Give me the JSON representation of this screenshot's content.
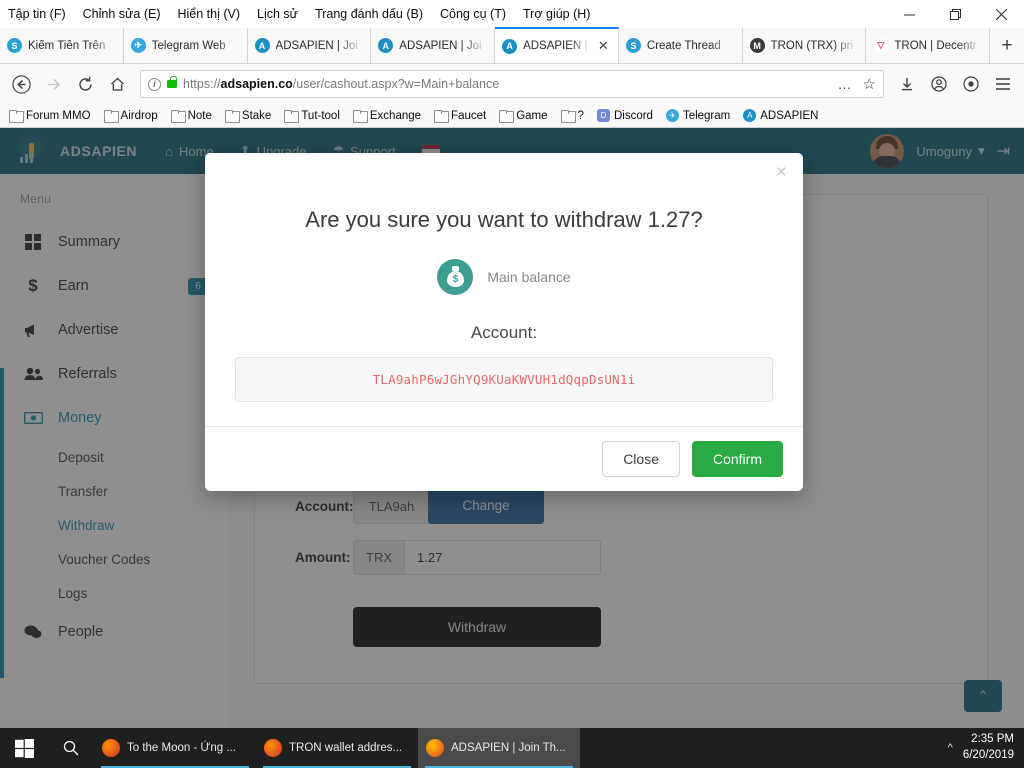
{
  "browser": {
    "menu": [
      {
        "label": "Tập tin (F)"
      },
      {
        "label": "Chỉnh sửa (E)"
      },
      {
        "label": "Hiển thị (V)"
      },
      {
        "label": "Lịch sử"
      },
      {
        "label": "Trang đánh dấu (B)"
      },
      {
        "label": "Công cụ (T)"
      },
      {
        "label": "Trợ giúp (H)"
      }
    ],
    "window_controls": {
      "minimize": "minimize-icon",
      "restore": "restore-icon",
      "close": "close-icon"
    },
    "tabs": [
      {
        "title": "Kiếm Tiền Trên",
        "icon": "steemit-icon",
        "color": "#2b9ed4",
        "active": false
      },
      {
        "title": "Telegram Web",
        "icon": "telegram-icon",
        "color": "#34a9e0",
        "active": false
      },
      {
        "title": "ADSAPIEN | Joi",
        "icon": "adsapien-icon",
        "color": "#1b8ec4",
        "active": false
      },
      {
        "title": "ADSAPIEN | Joi",
        "icon": "adsapien-icon",
        "color": "#1b8ec4",
        "active": false
      },
      {
        "title": "ADSAPIEN |",
        "icon": "adsapien-icon",
        "color": "#1b8ec4",
        "active": true
      },
      {
        "title": "Create Thread",
        "icon": "steemit-icon",
        "color": "#2b9ed4",
        "active": false
      },
      {
        "title": "TRON (TRX) pri",
        "icon": "coinmarketcap-icon",
        "color": "#3a3a3a",
        "active": false
      },
      {
        "title": "TRON | Decentr",
        "icon": "tron-icon",
        "color": "#e8426a",
        "active": false
      }
    ],
    "new_tab_label": "+",
    "tab_close_label": "✕",
    "nav": {
      "back": "back-icon",
      "forward": "forward-icon",
      "reload": "reload-icon",
      "home": "home-icon",
      "url_prefix": "https://",
      "url_domain": "adsapien.co",
      "url_path": "/user/cashout.aspx?w=Main+balance",
      "page_actions": "…",
      "bookmark_star": "☆",
      "downloads": "download-icon",
      "account": "account-icon",
      "sync": "sync-icon",
      "menu": "hamburger-icon"
    },
    "bookmarks": [
      {
        "label": "Forum MMO",
        "type": "folder"
      },
      {
        "label": "Airdrop",
        "type": "folder"
      },
      {
        "label": "Note",
        "type": "folder"
      },
      {
        "label": "Stake",
        "type": "folder"
      },
      {
        "label": "Tut-tool",
        "type": "folder"
      },
      {
        "label": "Exchange",
        "type": "folder"
      },
      {
        "label": "Faucet",
        "type": "folder"
      },
      {
        "label": "Game",
        "type": "folder"
      },
      {
        "label": "?",
        "type": "folder"
      },
      {
        "label": "Discord",
        "type": "site",
        "color": "#7289da",
        "glyph": "D"
      },
      {
        "label": "Telegram",
        "type": "site",
        "color": "#34a9e0",
        "glyph": "✈"
      },
      {
        "label": "ADSAPIEN",
        "type": "site",
        "color": "#1b8ec4",
        "glyph": "A"
      }
    ]
  },
  "site": {
    "brand": "ADSAPIEN",
    "nav": [
      {
        "label": "Home",
        "icon": "home-icon"
      },
      {
        "label": "Upgrade",
        "icon": "rocket-icon"
      },
      {
        "label": "Support",
        "icon": "lifebuoy-icon"
      },
      {
        "label": "",
        "icon": "flag-icon"
      }
    ],
    "user": {
      "name": "Umoguny",
      "caret": "▾",
      "avatar": "avatar",
      "logout": "logout-icon"
    }
  },
  "sidebar": {
    "heading": "Menu",
    "items": [
      {
        "label": "Summary",
        "icon": "grid-icon",
        "active": false,
        "badge": null
      },
      {
        "label": "Earn",
        "icon": "dollar-icon",
        "active": false,
        "badge": "6"
      },
      {
        "label": "Advertise",
        "icon": "megaphone-icon",
        "active": false,
        "badge": null
      },
      {
        "label": "Referrals",
        "icon": "users-icon",
        "active": false,
        "badge": null
      },
      {
        "label": "Money",
        "icon": "money-icon",
        "active": true,
        "badge": null
      }
    ],
    "sub_items": [
      {
        "label": "Deposit",
        "active": false
      },
      {
        "label": "Transfer",
        "active": false
      },
      {
        "label": "Withdraw",
        "active": true
      },
      {
        "label": "Voucher Codes",
        "active": false
      },
      {
        "label": "Logs",
        "active": false
      }
    ],
    "items_after": [
      {
        "label": "People",
        "icon": "chat-icon",
        "active": false,
        "badge": null
      }
    ]
  },
  "form": {
    "account_label": "Account:",
    "account_value": "TLA9ah",
    "change_button": "Change",
    "amount_label": "Amount:",
    "currency": "TRX",
    "amount_value": "1.27",
    "withdraw_button": "Withdraw",
    "scroll_top_icon": "chevron-up-icon"
  },
  "modal": {
    "close_icon": "×",
    "title": "Are you sure you want to withdraw 1.27?",
    "balance_icon": "money-bag-icon",
    "balance_label": "Main balance",
    "account_heading": "Account:",
    "account_address": "TLA9ahP6wJGhYQ9KUaKWVUH1dQqpDsUN1i",
    "buttons": {
      "close": "Close",
      "confirm": "Confirm"
    },
    "colors": {
      "confirm": "#2aaa43",
      "address_text": "#e66a6a",
      "icon": "#3d9e92"
    }
  },
  "taskbar": {
    "start_icon": "windows-icon",
    "search_icon": "search-icon",
    "apps": [
      {
        "label": "To the Moon - Ứng ...",
        "icon": "firefox-icon",
        "active": false
      },
      {
        "label": "TRON wallet addres...",
        "icon": "firefox-icon",
        "active": false
      },
      {
        "label": "ADSAPIEN | Join Th...",
        "icon": "firefox-icon",
        "active": true
      }
    ],
    "tray_chevron": "^",
    "time": "2:35 PM",
    "date": "6/20/2019"
  },
  "theme": {
    "header_bg": "#1a6b7d",
    "accent": "#2392b3",
    "confirm_green": "#2aaa43",
    "change_blue": "#2c6aa8"
  }
}
